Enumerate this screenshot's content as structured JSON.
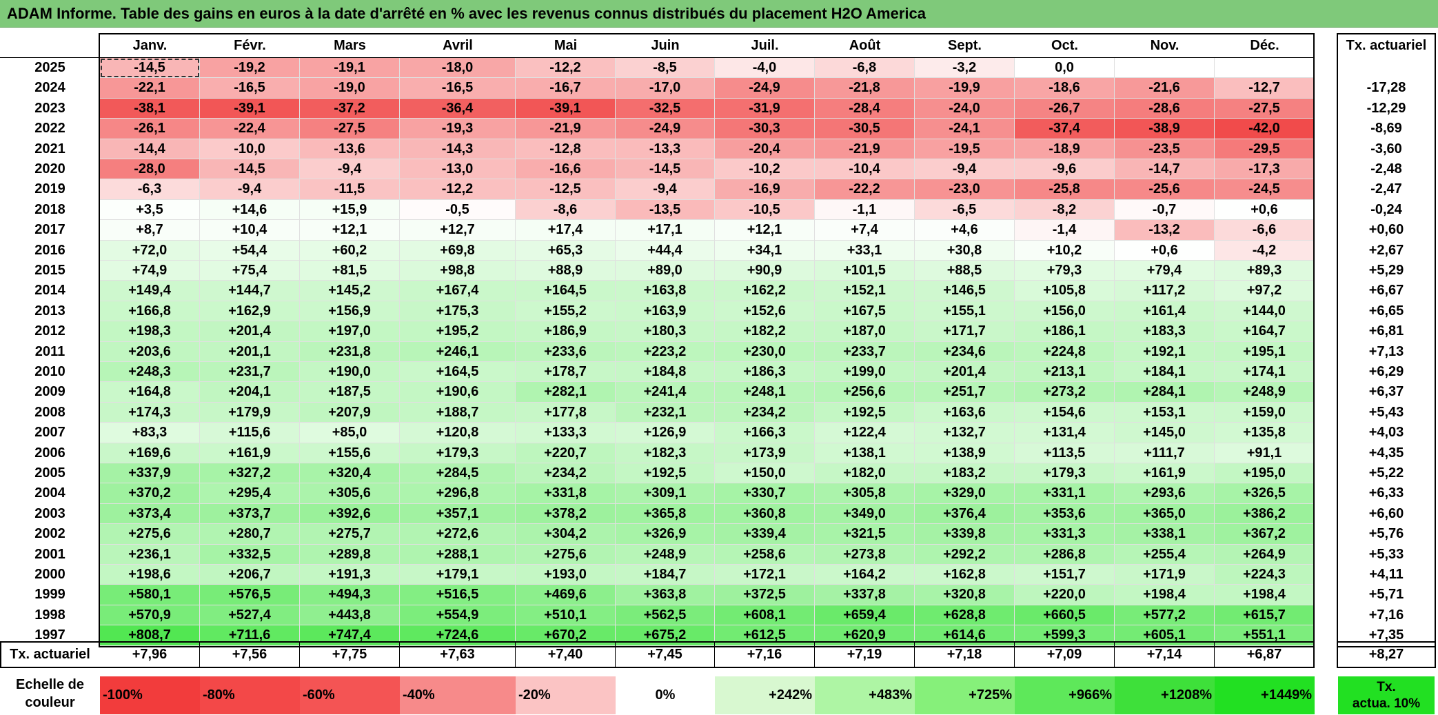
{
  "title": "ADAM Informe. Table des gains en euros à la date d'arrêté en % avec les revenus connus distribués du placement H2O America",
  "months": [
    "Janv.",
    "Févr.",
    "Mars",
    "Avril",
    "Mai",
    "Juin",
    "Juil.",
    "Août",
    "Sept.",
    "Oct.",
    "Nov.",
    "Déc."
  ],
  "rate_header": "Tx. actuariel",
  "rows": [
    {
      "year": "2025",
      "values": [
        "-14,5",
        "-19,2",
        "-19,1",
        "-18,0",
        "-12,2",
        "-8,5",
        "-4,0",
        "-6,8",
        "-3,2",
        "0,0",
        "",
        ""
      ],
      "rate": ""
    },
    {
      "year": "2024",
      "values": [
        "-22,1",
        "-16,5",
        "-19,0",
        "-16,5",
        "-16,7",
        "-17,0",
        "-24,9",
        "-21,8",
        "-19,9",
        "-18,6",
        "-21,6",
        "-12,7"
      ],
      "rate": "-17,28"
    },
    {
      "year": "2023",
      "values": [
        "-38,1",
        "-39,1",
        "-37,2",
        "-36,4",
        "-39,1",
        "-32,5",
        "-31,9",
        "-28,4",
        "-24,0",
        "-26,7",
        "-28,6",
        "-27,5"
      ],
      "rate": "-12,29"
    },
    {
      "year": "2022",
      "values": [
        "-26,1",
        "-22,4",
        "-27,5",
        "-19,3",
        "-21,9",
        "-24,9",
        "-30,3",
        "-30,5",
        "-24,1",
        "-37,4",
        "-38,9",
        "-42,0"
      ],
      "rate": "-8,69"
    },
    {
      "year": "2021",
      "values": [
        "-14,4",
        "-10,0",
        "-13,6",
        "-14,3",
        "-12,8",
        "-13,3",
        "-20,4",
        "-21,9",
        "-19,5",
        "-18,9",
        "-23,5",
        "-29,5"
      ],
      "rate": "-3,60"
    },
    {
      "year": "2020",
      "values": [
        "-28,0",
        "-14,5",
        "-9,4",
        "-13,0",
        "-16,6",
        "-14,5",
        "-10,2",
        "-10,4",
        "-9,4",
        "-9,6",
        "-14,7",
        "-17,3"
      ],
      "rate": "-2,48"
    },
    {
      "year": "2019",
      "values": [
        "-6,3",
        "-9,4",
        "-11,5",
        "-12,2",
        "-12,5",
        "-9,4",
        "-16,9",
        "-22,2",
        "-23,0",
        "-25,8",
        "-25,6",
        "-24,5"
      ],
      "rate": "-2,47"
    },
    {
      "year": "2018",
      "values": [
        "+3,5",
        "+14,6",
        "+15,9",
        "-0,5",
        "-8,6",
        "-13,5",
        "-10,5",
        "-1,1",
        "-6,5",
        "-8,2",
        "-0,7",
        "+0,6"
      ],
      "rate": "-0,24"
    },
    {
      "year": "2017",
      "values": [
        "+8,7",
        "+10,4",
        "+12,1",
        "+12,7",
        "+17,4",
        "+17,1",
        "+12,1",
        "+7,4",
        "+4,6",
        "-1,4",
        "-13,2",
        "-6,6"
      ],
      "rate": "+0,60"
    },
    {
      "year": "2016",
      "values": [
        "+72,0",
        "+54,4",
        "+60,2",
        "+69,8",
        "+65,3",
        "+44,4",
        "+34,1",
        "+33,1",
        "+30,8",
        "+10,2",
        "+0,6",
        "-4,2"
      ],
      "rate": "+2,67"
    },
    {
      "year": "2015",
      "values": [
        "+74,9",
        "+75,4",
        "+81,5",
        "+98,8",
        "+88,9",
        "+89,0",
        "+90,9",
        "+101,5",
        "+88,5",
        "+79,3",
        "+79,4",
        "+89,3"
      ],
      "rate": "+5,29"
    },
    {
      "year": "2014",
      "values": [
        "+149,4",
        "+144,7",
        "+145,2",
        "+167,4",
        "+164,5",
        "+163,8",
        "+162,2",
        "+152,1",
        "+146,5",
        "+105,8",
        "+117,2",
        "+97,2"
      ],
      "rate": "+6,67"
    },
    {
      "year": "2013",
      "values": [
        "+166,8",
        "+162,9",
        "+156,9",
        "+175,3",
        "+155,2",
        "+163,9",
        "+152,6",
        "+167,5",
        "+155,1",
        "+156,0",
        "+161,4",
        "+144,0"
      ],
      "rate": "+6,65"
    },
    {
      "year": "2012",
      "values": [
        "+198,3",
        "+201,4",
        "+197,0",
        "+195,2",
        "+186,9",
        "+180,3",
        "+182,2",
        "+187,0",
        "+171,7",
        "+186,1",
        "+183,3",
        "+164,7"
      ],
      "rate": "+6,81"
    },
    {
      "year": "2011",
      "values": [
        "+203,6",
        "+201,1",
        "+231,8",
        "+246,1",
        "+233,6",
        "+223,2",
        "+230,0",
        "+233,7",
        "+234,6",
        "+224,8",
        "+192,1",
        "+195,1"
      ],
      "rate": "+7,13"
    },
    {
      "year": "2010",
      "values": [
        "+248,3",
        "+231,7",
        "+190,0",
        "+164,5",
        "+178,7",
        "+184,8",
        "+186,3",
        "+199,0",
        "+201,4",
        "+213,1",
        "+184,1",
        "+174,1"
      ],
      "rate": "+6,29"
    },
    {
      "year": "2009",
      "values": [
        "+164,8",
        "+204,1",
        "+187,5",
        "+190,6",
        "+282,1",
        "+241,4",
        "+248,1",
        "+256,6",
        "+251,7",
        "+273,2",
        "+284,1",
        "+248,9"
      ],
      "rate": "+6,37"
    },
    {
      "year": "2008",
      "values": [
        "+174,3",
        "+179,9",
        "+207,9",
        "+188,7",
        "+177,8",
        "+232,1",
        "+234,2",
        "+192,5",
        "+163,6",
        "+154,6",
        "+153,1",
        "+159,0"
      ],
      "rate": "+5,43"
    },
    {
      "year": "2007",
      "values": [
        "+83,3",
        "+115,6",
        "+85,0",
        "+120,8",
        "+133,3",
        "+126,9",
        "+166,3",
        "+122,4",
        "+132,7",
        "+131,4",
        "+145,0",
        "+135,8"
      ],
      "rate": "+4,03"
    },
    {
      "year": "2006",
      "values": [
        "+169,6",
        "+161,9",
        "+155,6",
        "+179,3",
        "+220,7",
        "+182,3",
        "+173,9",
        "+138,1",
        "+138,9",
        "+113,5",
        "+111,7",
        "+91,1"
      ],
      "rate": "+4,35"
    },
    {
      "year": "2005",
      "values": [
        "+337,9",
        "+327,2",
        "+320,4",
        "+284,5",
        "+234,2",
        "+192,5",
        "+150,0",
        "+182,0",
        "+183,2",
        "+179,3",
        "+161,9",
        "+195,0"
      ],
      "rate": "+5,22"
    },
    {
      "year": "2004",
      "values": [
        "+370,2",
        "+295,4",
        "+305,6",
        "+296,8",
        "+331,8",
        "+309,1",
        "+330,7",
        "+305,8",
        "+329,0",
        "+331,1",
        "+293,6",
        "+326,5"
      ],
      "rate": "+6,33"
    },
    {
      "year": "2003",
      "values": [
        "+373,4",
        "+373,7",
        "+392,6",
        "+357,1",
        "+378,2",
        "+365,8",
        "+360,8",
        "+349,0",
        "+376,4",
        "+353,6",
        "+365,0",
        "+386,2"
      ],
      "rate": "+6,60"
    },
    {
      "year": "2002",
      "values": [
        "+275,6",
        "+280,7",
        "+275,7",
        "+272,6",
        "+304,2",
        "+326,9",
        "+339,4",
        "+321,5",
        "+339,8",
        "+331,3",
        "+338,1",
        "+367,2"
      ],
      "rate": "+5,76"
    },
    {
      "year": "2001",
      "values": [
        "+236,1",
        "+332,5",
        "+289,8",
        "+288,1",
        "+275,6",
        "+248,9",
        "+258,6",
        "+273,8",
        "+292,2",
        "+286,8",
        "+255,4",
        "+264,9"
      ],
      "rate": "+5,33"
    },
    {
      "year": "2000",
      "values": [
        "+198,6",
        "+206,7",
        "+191,3",
        "+179,1",
        "+193,0",
        "+184,7",
        "+172,1",
        "+164,2",
        "+162,8",
        "+151,7",
        "+171,9",
        "+224,3"
      ],
      "rate": "+4,11"
    },
    {
      "year": "1999",
      "values": [
        "+580,1",
        "+576,5",
        "+494,3",
        "+516,5",
        "+469,6",
        "+363,8",
        "+372,5",
        "+337,8",
        "+320,8",
        "+220,0",
        "+198,4",
        "+198,4"
      ],
      "rate": "+5,71"
    },
    {
      "year": "1998",
      "values": [
        "+570,9",
        "+527,4",
        "+443,8",
        "+554,9",
        "+510,1",
        "+562,5",
        "+608,1",
        "+659,4",
        "+628,8",
        "+660,5",
        "+577,2",
        "+615,7"
      ],
      "rate": "+7,16"
    },
    {
      "year": "1997",
      "values": [
        "+808,7",
        "+711,6",
        "+747,4",
        "+724,6",
        "+670,2",
        "+675,2",
        "+612,5",
        "+620,9",
        "+614,6",
        "+599,3",
        "+605,1",
        "+551,1"
      ],
      "rate": "+7,35"
    }
  ],
  "footer": {
    "label": "Tx. actuariel",
    "values": [
      "+7,96",
      "+7,56",
      "+7,75",
      "+7,63",
      "+7,40",
      "+7,45",
      "+7,16",
      "+7,19",
      "+7,18",
      "+7,09",
      "+7,14",
      "+6,87"
    ],
    "rate": "+8,27"
  },
  "scale": {
    "label_line1": "Echelle de",
    "label_line2": "couleur",
    "cells": [
      "-100%",
      "-80%",
      "-60%",
      "-40%",
      "-20%",
      "0%",
      "+242%",
      "+483%",
      "+725%",
      "+966%",
      "+1208%",
      "+1449%"
    ],
    "colors": [
      "#f23c3c",
      "#f34848",
      "#f45454",
      "#f78a8a",
      "#fbc4c4",
      "#ffffff",
      "#d8f8d0",
      "#aef5a4",
      "#86f07a",
      "#5ee85a",
      "#3ee03a",
      "#22e022"
    ],
    "rate_line1": "Tx.",
    "rate_line2": "actua. 10%"
  },
  "colors": {
    "title_bg": "#7fc97a",
    "negative": "#f04040",
    "positive": "#22e022"
  }
}
